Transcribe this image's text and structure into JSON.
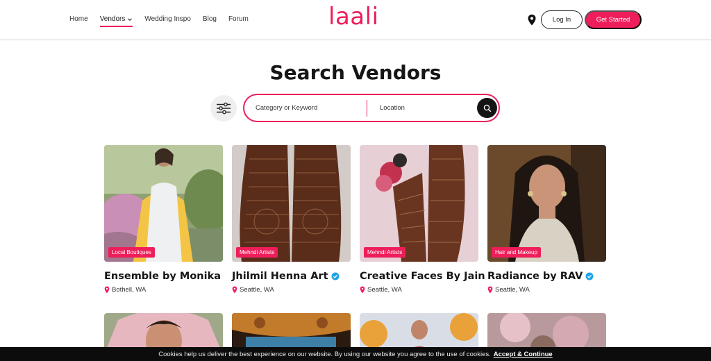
{
  "brand": {
    "logo": "laali",
    "accent": "#ee1e5b"
  },
  "nav": {
    "items": [
      {
        "label": "Home"
      },
      {
        "label": "Vendors",
        "active": true
      },
      {
        "label": "Wedding Inspo"
      },
      {
        "label": "Blog"
      },
      {
        "label": "Forum"
      }
    ]
  },
  "header": {
    "login_label": "Log In",
    "start_label": "Get Started",
    "location_icon": "map-pin-icon"
  },
  "search": {
    "title": "Search Vendors",
    "keyword_placeholder": "Category or Keyword",
    "location_placeholder": "Location",
    "filter_icon": "sliders-icon",
    "submit_icon": "search-icon"
  },
  "vendors": [
    {
      "name": "Ensemble by Monika",
      "category": "Local Boutiques",
      "location": "Bothell, WA",
      "verified": false
    },
    {
      "name": "Jhilmil Henna Art",
      "category": "Mehndi Artists",
      "location": "Seattle, WA",
      "verified": true
    },
    {
      "name": "Creative Faces By Jain",
      "category": "Mehndi Artists",
      "location": "Seattle, WA",
      "verified": true
    },
    {
      "name": "Radiance by RAV",
      "category": "Hair and Makeup",
      "location": "Seattle, WA",
      "verified": true
    }
  ],
  "cookie": {
    "text": "Cookies help us deliver the best experience on our website. By using our website you agree to the use of cookies.",
    "accept_label": "Accept & Continue"
  }
}
